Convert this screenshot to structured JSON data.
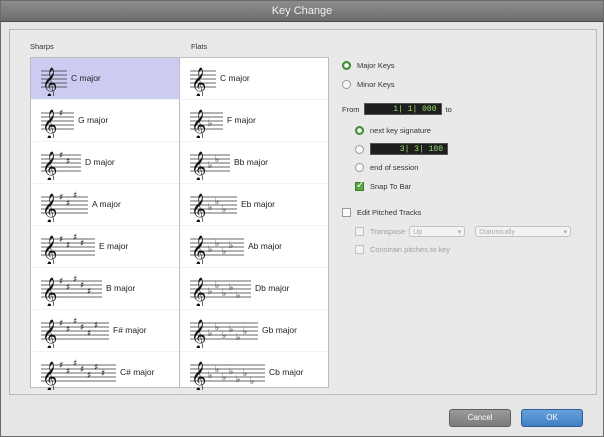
{
  "window": {
    "title": "Key Change"
  },
  "columns": {
    "sharps_label": "Sharps",
    "flats_label": "Flats"
  },
  "sharps": [
    {
      "label": "C major",
      "accidentals": 0,
      "selected": true
    },
    {
      "label": "G major",
      "accidentals": 1,
      "selected": false
    },
    {
      "label": "D major",
      "accidentals": 2,
      "selected": false
    },
    {
      "label": "A major",
      "accidentals": 3,
      "selected": false
    },
    {
      "label": "E major",
      "accidentals": 4,
      "selected": false
    },
    {
      "label": "B major",
      "accidentals": 5,
      "selected": false
    },
    {
      "label": "F# major",
      "accidentals": 6,
      "selected": false
    },
    {
      "label": "C# major",
      "accidentals": 7,
      "selected": false
    }
  ],
  "flats": [
    {
      "label": "C major",
      "accidentals": 0
    },
    {
      "label": "F major",
      "accidentals": 1
    },
    {
      "label": "Bb major",
      "accidentals": 2
    },
    {
      "label": "Eb major",
      "accidentals": 3
    },
    {
      "label": "Ab major",
      "accidentals": 4
    },
    {
      "label": "Db major",
      "accidentals": 5
    },
    {
      "label": "Gb major",
      "accidentals": 6
    },
    {
      "label": "Cb major",
      "accidentals": 7
    }
  ],
  "mode": {
    "major_label": "Major Keys",
    "minor_label": "Minor Keys",
    "selected": "major"
  },
  "range": {
    "from_label": "From",
    "from_value": "1| 1| 000",
    "to_label": "to",
    "next_key_label": "next key signature",
    "to_value": "3| 3| 100",
    "end_label": "end of session",
    "selected": "next"
  },
  "snap": {
    "label": "Snap To Bar",
    "checked": true
  },
  "pitched": {
    "label": "Edit Pitched Tracks",
    "checked": false,
    "transpose_label": "Transpose",
    "direction_value": "Up",
    "interval_value": "Diatonically",
    "constrain_label": "Constrain pitches to key"
  },
  "buttons": {
    "cancel": "Cancel",
    "ok": "OK"
  },
  "colors": {
    "accent": "#3f7fc2",
    "selection": "#ccccf2",
    "counter_text": "#9ee36b",
    "radio_on": "#4f9e3a"
  }
}
